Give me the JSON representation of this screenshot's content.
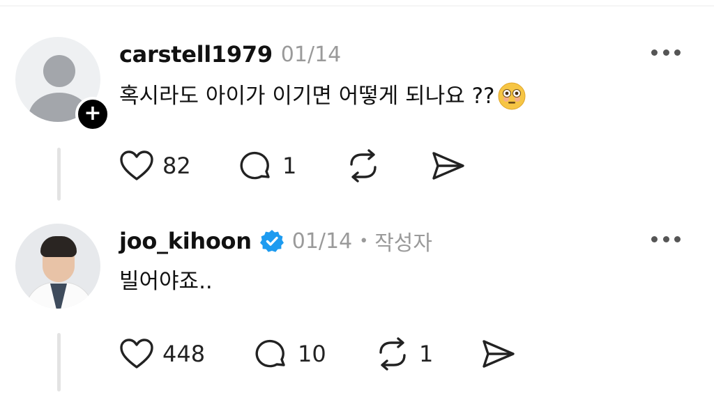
{
  "comments": [
    {
      "username": "carstell1979",
      "date": "01/14",
      "verified": false,
      "author_tag": "",
      "text": "혹시라도 아이가 이기면 어떻게 되나요 ??",
      "emoji": "flushed-face-emoji",
      "avatar": "default-avatar",
      "follow_badge": "+",
      "likes": "82",
      "replies": "1",
      "reposts": "",
      "shares": ""
    },
    {
      "username": "joo_kihoon",
      "date": "01/14",
      "verified": true,
      "dot": "•",
      "author_tag": "작성자",
      "text": "빌어야죠..",
      "avatar": "profile-photo",
      "likes": "448",
      "replies": "10",
      "reposts": "1",
      "shares": ""
    }
  ],
  "colors": {
    "text": "#111111",
    "muted": "#9a9a9a",
    "verified": "#1d9bf0",
    "thread_line": "#e3e3e3"
  },
  "icons": [
    "heart-icon",
    "comment-icon",
    "repost-icon",
    "send-icon",
    "more-icon",
    "verified-icon"
  ]
}
